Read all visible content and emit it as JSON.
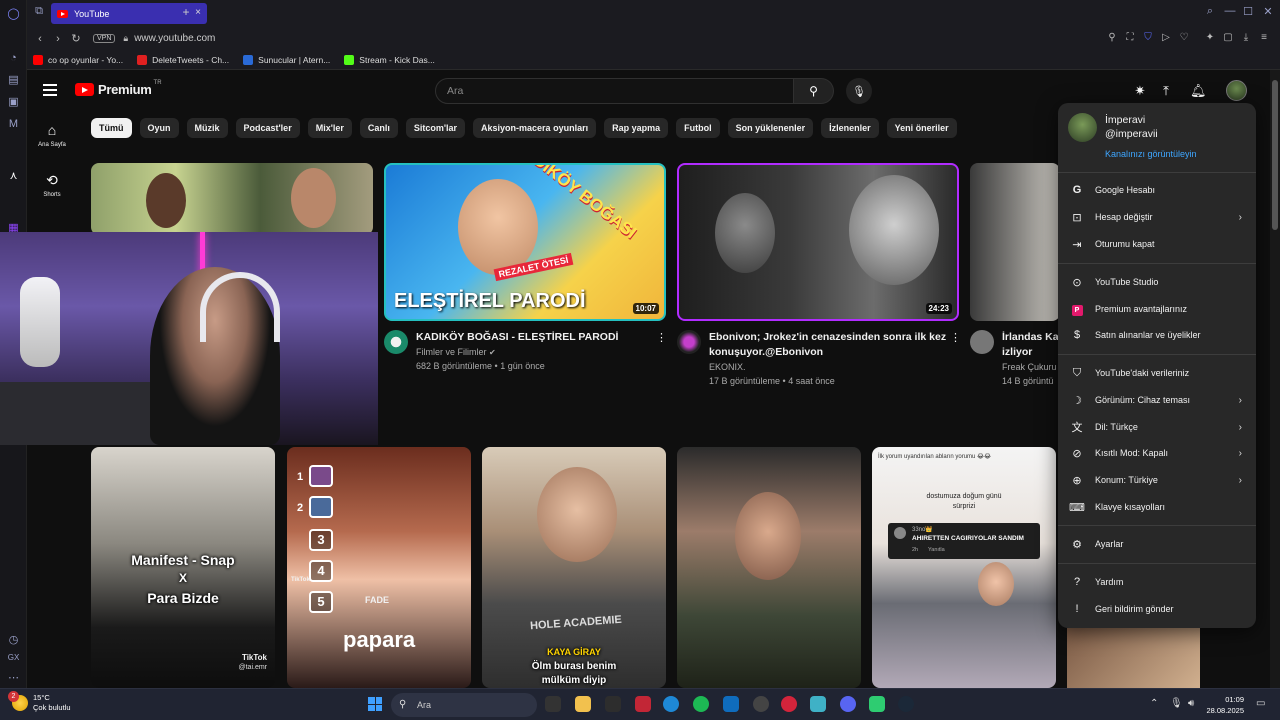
{
  "browser": {
    "tab_title": "YouTube",
    "url": "www.youtube.com",
    "vpn_label": "VPN",
    "bookmarks": [
      {
        "label": "co op oyunlar - Yo...",
        "color": "#ff0000"
      },
      {
        "label": "DeleteTweets - Ch...",
        "color": "#e02020"
      },
      {
        "label": "Sunucular | Atern...",
        "color": "#2a6ad6"
      },
      {
        "label": "Stream - Kick Das...",
        "color": "#53fc18"
      }
    ]
  },
  "youtube": {
    "logo_text": "Premium",
    "region": "TR",
    "search_placeholder": "Ara",
    "nav": [
      {
        "label": "Ana Sayfa",
        "icon": "home-icon"
      },
      {
        "label": "Shorts",
        "icon": "shorts-icon"
      }
    ],
    "chips": [
      "Tümü",
      "Oyun",
      "Müzik",
      "Podcast'ler",
      "Mix'ler",
      "Canlı",
      "Sitcom'lar",
      "Aksiyon-macera oyunları",
      "Rap yapma",
      "Futbol",
      "Son yüklenenler",
      "İzlenenler",
      "Yeni öneriler"
    ],
    "videos": [
      {
        "title": "KADIKÖY BOĞASI - ELEŞTİREL PARODİ",
        "channel": "Filmler ve Filimler",
        "stats": "682 B görüntüleme • 1 gün önce",
        "duration": "10:07",
        "thumb_text": "ELEŞTİREL PARODİ",
        "thumb_badge": "REZALET ÖTESİ",
        "thumb_slant": "KADIKÖY BOĞASI"
      },
      {
        "title_line1": "Ebonivon; Jrokez'in cenazesinden sonra ilk kez",
        "title_line2": "konuşuyor.@Ebonivon",
        "channel": "EKONIX.",
        "stats": "17 B görüntüleme • 4 saat önce",
        "duration": "24:23"
      },
      {
        "title_line1": "İrlandas Ka",
        "title_line2": "izliyor",
        "channel": "Freak Çukuru",
        "stats": "14 B görüntü"
      }
    ],
    "shorts": [
      {
        "caption_1": "Manifest - Snap",
        "caption_2": "X",
        "caption_3": "Para Bizde",
        "watermark": "TikTok",
        "handle": "@tai.emr"
      },
      {
        "ranks": [
          "1",
          "2",
          "3",
          "4",
          "5"
        ],
        "caption": "FADE",
        "watermark": "TikTok",
        "shirt": "papara"
      },
      {
        "shirt": "HOLE ACADEMIE",
        "caption_1": "KAYA GİRAY",
        "caption_2": "Ölm burası benim",
        "caption_3": "mülküm diyip"
      },
      {},
      {
        "top_text": "İlk yorum uyandırılan abların yorumu 😂😂",
        "caption_1": "dostumuza doğum günü",
        "caption_2": "sürprizi",
        "comment_user": "33no👑",
        "comment_text": "AHIRETTEN CAGIRIYOLAR SANDIM",
        "comment_meta_1": "2h",
        "comment_meta_2": "Yanıtla"
      }
    ]
  },
  "account_menu": {
    "name": "İmperavi",
    "handle": "@imperavii",
    "channel_link": "Kanalınızı görüntüleyin",
    "items": [
      {
        "label": "Google Hesabı",
        "icon": "google-icon",
        "chevron": false
      },
      {
        "label": "Hesap değiştir",
        "icon": "switch-account-icon",
        "chevron": true
      },
      {
        "label": "Oturumu kapat",
        "icon": "sign-out-icon",
        "chevron": false
      },
      {
        "label": "YouTube Studio",
        "icon": "studio-icon",
        "chevron": false
      },
      {
        "label": "Premium avantajlarınız",
        "icon": "premium-icon",
        "chevron": false
      },
      {
        "label": "Satın alınanlar ve üyelikler",
        "icon": "dollar-icon",
        "chevron": false
      },
      {
        "label": "YouTube'daki verileriniz",
        "icon": "shield-icon",
        "chevron": false
      },
      {
        "label": "Görünüm: Cihaz teması",
        "icon": "moon-icon",
        "chevron": true
      },
      {
        "label": "Dil: Türkçe",
        "icon": "translate-icon",
        "chevron": true
      },
      {
        "label": "Kısıtlı Mod: Kapalı",
        "icon": "restricted-icon",
        "chevron": true
      },
      {
        "label": "Konum: Türkiye",
        "icon": "globe-icon",
        "chevron": true
      },
      {
        "label": "Klavye kısayolları",
        "icon": "keyboard-icon",
        "chevron": false
      },
      {
        "label": "Ayarlar",
        "icon": "gear-icon",
        "chevron": false
      },
      {
        "label": "Yardım",
        "icon": "help-icon",
        "chevron": false
      },
      {
        "label": "Geri bildirim gönder",
        "icon": "feedback-icon",
        "chevron": false
      }
    ]
  },
  "taskbar": {
    "temperature": "15°C",
    "weather": "Çok bulutlu",
    "weather_badge": "2",
    "search_placeholder": "Ara",
    "time": "01:09",
    "date": "28.08.2025"
  },
  "colors": {
    "brand_red": "#ff0000",
    "link_blue": "#3ea6ff",
    "opera_tab": "#3a2fb0"
  }
}
